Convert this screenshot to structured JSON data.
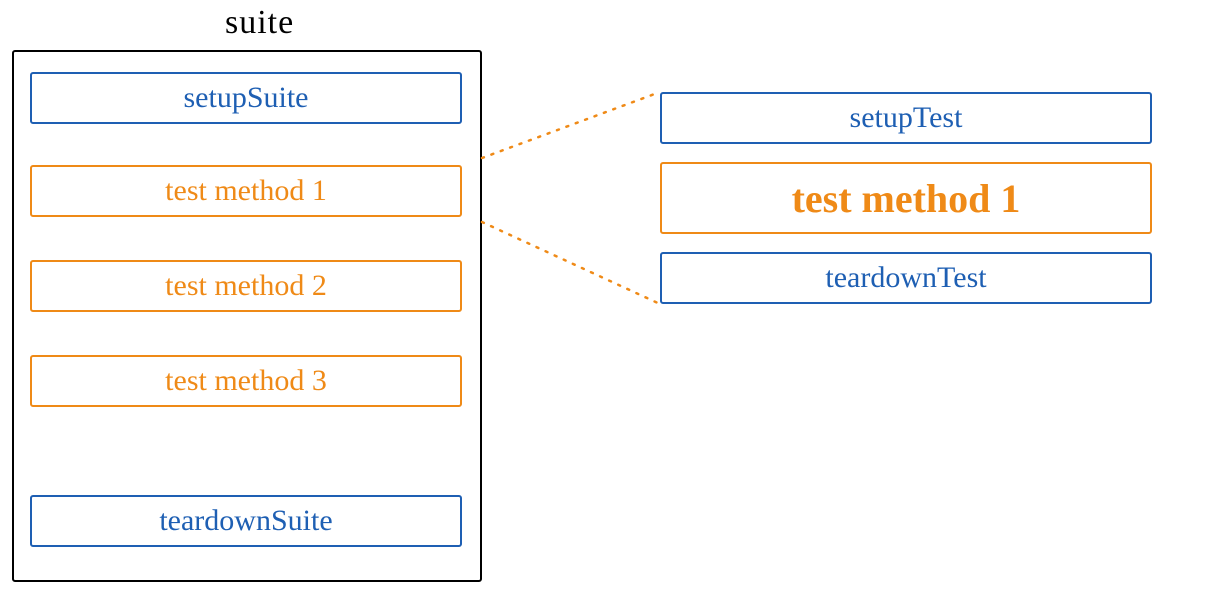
{
  "suite": {
    "title": "suite",
    "setup": "setupSuite",
    "tests": [
      "test method 1",
      "test method 2",
      "test method 3"
    ],
    "teardown": "teardownSuite"
  },
  "detail": {
    "setup": "setupTest",
    "method": "test method 1",
    "teardown": "teardownTest"
  },
  "colors": {
    "blue": "#1e5fb3",
    "orange": "#ef8a17",
    "black": "#000000"
  }
}
